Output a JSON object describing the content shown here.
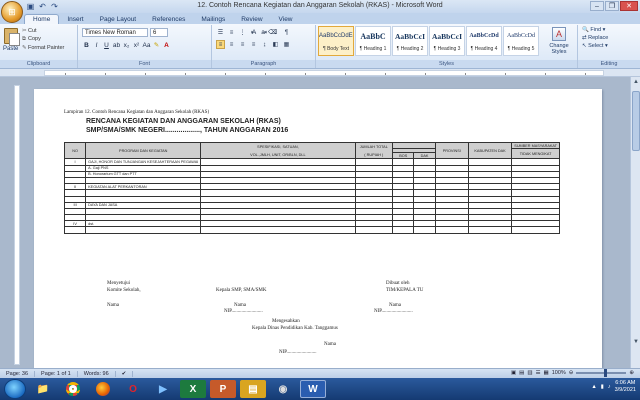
{
  "window": {
    "title": "12. Contoh Rencana Kegiatan dan Anggaran Sekolah (RKAS) - Microsoft Word"
  },
  "tabs": [
    "Home",
    "Insert",
    "Page Layout",
    "References",
    "Mailings",
    "Review",
    "View"
  ],
  "clipboard": {
    "paste": "Paste",
    "cut": "Cut",
    "copy": "Copy",
    "format_painter": "Format Painter",
    "label": "Clipboard"
  },
  "font": {
    "name": "Times New Roman",
    "size": "6",
    "label": "Font"
  },
  "paragraph": {
    "label": "Paragraph"
  },
  "styles": {
    "label": "Styles",
    "items": [
      {
        "sample": "AaBbCcDdEe",
        "name": "¶ Body Text"
      },
      {
        "sample": "AaBbC",
        "name": "¶ Heading 1"
      },
      {
        "sample": "AaBbCcI",
        "name": "¶ Heading 2"
      },
      {
        "sample": "AaBbCcI",
        "name": "¶ Heading 3"
      },
      {
        "sample": "AaBbCcDd",
        "name": "¶ Heading 4"
      },
      {
        "sample": "AaBbCcDd",
        "name": "¶ Heading 5"
      }
    ],
    "change_styles": "Change Styles"
  },
  "editing": {
    "find": "Find",
    "replace": "Replace",
    "select": "Select",
    "label": "Editing"
  },
  "document": {
    "lampiran": "Lampiran 12. Contoh Rencana Kegiatan dan Anggaran Sekolah (RKAS)",
    "title1": "RENCANA KEGIATAN DAN ANGGARAN SEKOLAH (RKAS)",
    "title2": "SMP/SMA/SMK NEGERI.................., TAHUN ANGGARAN 2016",
    "table": {
      "h_no": "NO",
      "h_program": "PROGRAM DAN KEGIATAN",
      "h_spesifikasi": "SPESIFIKASI, SATUAN,",
      "h_vol": "VOL.,JMLH, UNIT, OR/BLN, DLL",
      "h_jumlah": "JUMLAH TOTAL",
      "h_rupiah": "( RUPIAH )",
      "h_provinsi": "PROVINSI",
      "h_kab": "KABUPATEN DAK",
      "h_sumber": "SUMBER MASYARAKAT",
      "h_bos": "BOS",
      "h_dak": "DAK",
      "h_tidak": "TIDAK MENGIKAT",
      "rows": [
        {
          "no": "I",
          "text": "GAJI, HONOR DAN TUNJANGAN KESEJAHTERAAN PEGAWAI"
        },
        {
          "no": "",
          "text": "A. Gaji PNS"
        },
        {
          "no": "",
          "text": "B. Honorarium GTT dan PTT"
        },
        {
          "no": "",
          "text": ""
        },
        {
          "no": "II",
          "text": "KEGIATAN ALAT PERKANTORAN"
        },
        {
          "no": "",
          "text": ""
        },
        {
          "no": "",
          "text": ""
        },
        {
          "no": "III",
          "text": "DAYA DAN JASA"
        },
        {
          "no": "",
          "text": ""
        },
        {
          "no": "",
          "text": ""
        },
        {
          "no": "IV",
          "text": "dst."
        },
        {
          "no": "",
          "text": ""
        }
      ]
    },
    "sign": {
      "menyetujui": "Menyetujui",
      "komite": "Komite Sekolah,",
      "kepala": "Kepala SMP, SMA/SMK",
      "dibuat": "Dibuat oleh",
      "tu": "TIM/KEPALA TU",
      "nama1": "Nama",
      "nama2": "Nama",
      "nama3": "Nama",
      "nip2": "NIP.........................",
      "nip3": "NIP.........................",
      "mengesahkan": "Mengesahkan",
      "dinas": "Kepala Dinas Pendidikan  Kab. Tanggamus",
      "nama4": "Nama",
      "nip4": "NIP........................"
    }
  },
  "status": {
    "page": "Page: 36",
    "pages": "Page: 1 of 1",
    "words": "Words: 96",
    "zoom": "100%"
  },
  "clock": {
    "time": "6:06 AM",
    "date": "3/9/2021"
  }
}
